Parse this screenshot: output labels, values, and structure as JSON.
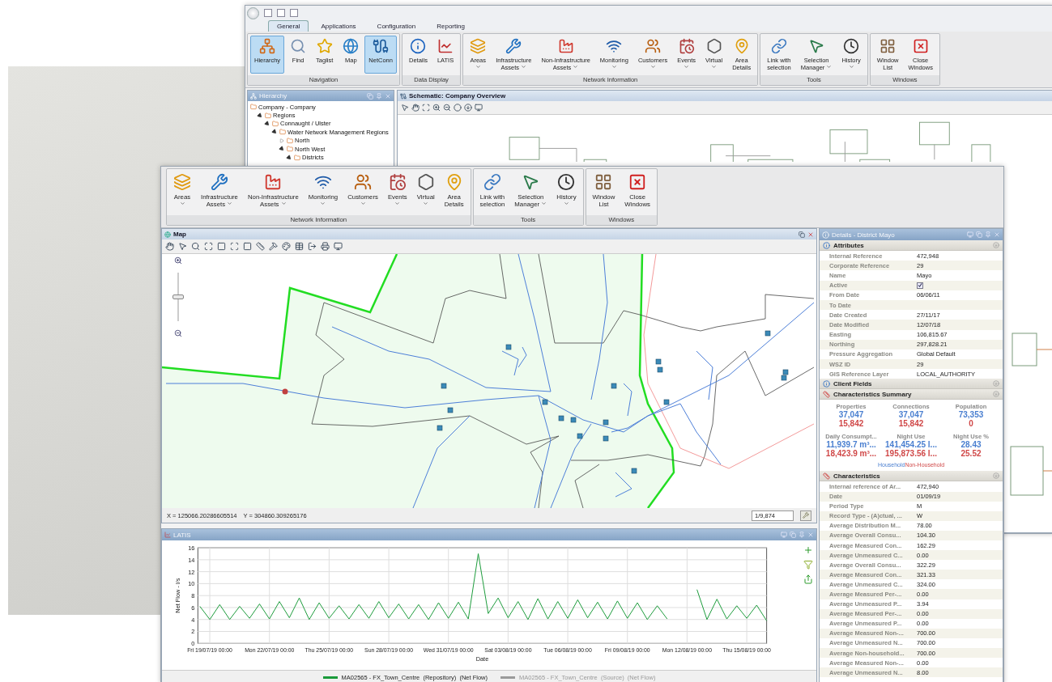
{
  "back_window": {
    "tabs": [
      {
        "label": "General",
        "selected": true
      },
      {
        "label": "Applications",
        "selected": false
      },
      {
        "label": "Configuration",
        "selected": false
      },
      {
        "label": "Reporting",
        "selected": false
      }
    ],
    "ribbon_groups": [
      {
        "kind": "navigation",
        "title": "Navigation",
        "items": [
          {
            "label": "Hierarchy",
            "selected": true
          },
          {
            "label": "Find",
            "selected": false
          },
          {
            "label": "Taglist",
            "selected": false
          },
          {
            "label": "Map",
            "selected": false
          },
          {
            "label": "NetConn",
            "selected": true
          }
        ]
      },
      {
        "kind": "data_display",
        "title": "Data Display",
        "items": [
          {
            "label": "Details",
            "selected": false
          },
          {
            "label": "LATIS",
            "selected": false
          }
        ]
      },
      {
        "kind": "network",
        "title": "Network Information",
        "items": [
          {
            "label": "Areas",
            "dropdown": true
          },
          {
            "label": "Infrastructure\nAssets",
            "dropdown": true
          },
          {
            "label": "Non-Infrastructure\nAssets",
            "dropdown": true
          },
          {
            "label": "Monitoring",
            "dropdown": true
          },
          {
            "label": "Customers",
            "dropdown": true
          },
          {
            "label": "Events",
            "dropdown": true
          },
          {
            "label": "Virtual",
            "dropdown": true
          },
          {
            "label": "Area\nDetails",
            "dropdown": false
          }
        ]
      },
      {
        "kind": "tools",
        "title": "Tools",
        "items": [
          {
            "label": "Link with\nselection",
            "dropdown": false
          },
          {
            "label": "Selection\nManager",
            "dropdown": true
          },
          {
            "label": "History",
            "dropdown": true
          }
        ]
      },
      {
        "kind": "windows",
        "title": "Windows",
        "items": [
          {
            "label": "Window\nList",
            "dropdown": false
          },
          {
            "label": "Close\nWindows",
            "dropdown": false
          }
        ]
      }
    ],
    "hierarchy": {
      "title": "Hierarchy",
      "tree": [
        {
          "label": "Company - Company",
          "children": [
            {
              "label": "Regions",
              "expanded": true,
              "children": [
                {
                  "label": "Connaught / Ulster",
                  "expanded": true,
                  "children": [
                    {
                      "label": "Water Network Management Regions",
                      "expanded": true,
                      "children": [
                        {
                          "label": "North",
                          "expanded": false
                        },
                        {
                          "label": "North West",
                          "expanded": true,
                          "children": [
                            {
                              "label": "Districts",
                              "expanded": true
                            }
                          ]
                        }
                      ]
                    }
                  ]
                }
              ]
            }
          ]
        }
      ]
    },
    "schematic": {
      "title": "Schematic: Company Overview"
    }
  },
  "front_window": {
    "ribbon_groups": [
      {
        "kind": "network",
        "title": "Network Information",
        "items": [
          {
            "label": "Areas",
            "dropdown": true
          },
          {
            "label": "Infrastructure\nAssets",
            "dropdown": true
          },
          {
            "label": "Non-Infrastructure\nAssets",
            "dropdown": true
          },
          {
            "label": "Monitoring",
            "dropdown": true
          },
          {
            "label": "Customers",
            "dropdown": true
          },
          {
            "label": "Events",
            "dropdown": true
          },
          {
            "label": "Virtual",
            "dropdown": true
          },
          {
            "label": "Area\nDetails",
            "dropdown": false
          }
        ]
      },
      {
        "kind": "tools",
        "title": "Tools",
        "items": [
          {
            "label": "Link with\nselection",
            "dropdown": false
          },
          {
            "label": "Selection\nManager",
            "dropdown": true
          },
          {
            "label": "History",
            "dropdown": true
          }
        ]
      },
      {
        "kind": "windows",
        "title": "Windows",
        "items": [
          {
            "label": "Window\nList",
            "dropdown": false
          },
          {
            "label": "Close\nWindows",
            "dropdown": false
          }
        ]
      }
    ],
    "map": {
      "title": "Map",
      "zoom": {
        "level": 0.5
      },
      "x_coordinate": "X = 125066.20286605514",
      "y_coordinate": "Y = 304860.309265176",
      "scale": "1/9,874"
    },
    "latis": {
      "title": "LATIS",
      "chart_data": {
        "type": "line",
        "grid": true,
        "xlabel": "Date",
        "ylabel": "Net Flow - l/s",
        "ylim": [
          0,
          16
        ],
        "yticks": [
          0,
          2,
          4,
          6,
          8,
          10,
          12,
          14,
          16
        ],
        "categories": [
          null,
          "Fri 19/07/19 00:00",
          null,
          null,
          null,
          null,
          null,
          "Mon 22/07/19 00:00",
          null,
          null,
          null,
          null,
          null,
          "Thu 25/07/19 00:00",
          null,
          null,
          null,
          null,
          null,
          "Sun 28/07/19 00:00",
          null,
          null,
          null,
          null,
          null,
          "Wed 31/07/19 00:00",
          null,
          null,
          null,
          null,
          null,
          "Sat 03/08/19 00:00",
          null,
          null,
          null,
          null,
          null,
          "Tue 06/08/19 00:00",
          null,
          null,
          null,
          null,
          null,
          "Fri 09/08/19 00:00",
          null,
          null,
          null,
          null,
          null,
          "Mon 12/08/19 00:00",
          null,
          null,
          null,
          null,
          null,
          "Thu 15/08/19 00:00",
          null,
          null
        ],
        "series": [
          {
            "name": "MA02565 - FX_Town_Centre  (Repository)  (Net Flow)",
            "color": "#1a9a3a",
            "values": [
              6.2,
              4.0,
              6.5,
              4.0,
              6.2,
              4.2,
              6.6,
              4.1,
              7.0,
              4.3,
              7.6,
              4.0,
              6.8,
              4.2,
              6.3,
              4.1,
              6.5,
              4.2,
              7.0,
              4.3,
              6.6,
              4.1,
              6.5,
              4.0,
              6.8,
              4.2,
              6.9,
              4.1,
              15.0,
              5.0,
              7.6,
              4.3,
              7.0,
              4.0,
              7.5,
              4.1,
              7.0,
              4.2,
              7.3,
              4.3,
              6.9,
              4.1,
              7.1,
              4.2,
              6.8,
              4.0,
              6.3,
              4.1,
              null,
              null,
              9.0,
              4.0,
              7.4,
              4.1,
              6.3,
              4.2,
              6.4,
              3.8
            ]
          }
        ]
      },
      "other_series": [
        {
          "label": "MA02565 - FX_Town_Centre  (Source)  (Net Flow)",
          "color": "#9a9a9a",
          "enabled": false
        }
      ]
    },
    "details": {
      "title": "Details - District Mayo",
      "attributes": {
        "title": "Attributes",
        "rows": [
          {
            "kind": "text",
            "label": "Internal Reference",
            "value": "472,948"
          },
          {
            "kind": "text",
            "label": "Corporate Reference",
            "value": "29"
          },
          {
            "kind": "text",
            "label": "Name",
            "value": "Mayo"
          },
          {
            "kind": "checkbox",
            "label": "Active",
            "checked": true
          },
          {
            "kind": "text",
            "label": "From Date",
            "value": "06/06/11"
          },
          {
            "kind": "text",
            "label": "To Date"
          },
          {
            "kind": "text",
            "label": "Date Created",
            "value": "27/11/17"
          },
          {
            "kind": "text",
            "label": "Date Modified",
            "value": "12/07/18"
          },
          {
            "kind": "text",
            "label": "Easting",
            "value": "106,815.67"
          },
          {
            "kind": "text",
            "label": "Northing",
            "value": "297,828.21"
          },
          {
            "kind": "text",
            "label": "Pressure Aggregation",
            "value": "Global Default"
          },
          {
            "kind": "text",
            "label": "WSZ ID",
            "value": "29"
          },
          {
            "kind": "text",
            "label": "GIS Reference Layer",
            "value": "LOCAL_AUTHORITY"
          }
        ]
      },
      "client_fields": {
        "title": "Client Fields"
      },
      "summary": {
        "title": "Characteristics Summary",
        "metrics": [
          {
            "label": "Properties",
            "household": "37,047",
            "non_household": "15,842"
          },
          {
            "label": "Connections",
            "household": "37,047",
            "non_household": "15,842"
          },
          {
            "label": "Population",
            "household": "73,353",
            "non_household": "0"
          },
          {
            "label": "Daily Consumpt...",
            "household": "11,939.7 m³...",
            "non_household": "18,423.9 m³..."
          },
          {
            "label": "Night Use",
            "household": "141,454.25 l...",
            "non_household": "195,873.56 l..."
          },
          {
            "label": "Night Use %",
            "household": "28.43",
            "non_household": "25.52"
          }
        ],
        "legend": [
          {
            "label": "Household",
            "color": "#4a7fd0"
          },
          {
            "label": "Non-Household",
            "color": "#d04848"
          }
        ]
      },
      "characteristics": {
        "title": "Characteristics",
        "rows": [
          {
            "label": "Internal reference of Ar...",
            "value": "472,940"
          },
          {
            "label": "Date",
            "value": "01/09/19"
          },
          {
            "label": "Period Type",
            "value": "M"
          },
          {
            "label": "Record Type - (A)ctual, ...",
            "value": "W"
          },
          {
            "label": "Average Distribution M...",
            "value": "78.00"
          },
          {
            "label": "Average Overall Consu...",
            "value": "104.30"
          },
          {
            "label": "Average Measured Con...",
            "value": "162.29"
          },
          {
            "label": "Average Unmeasured C...",
            "value": "0.00"
          },
          {
            "label": "Average Overall Consu...",
            "value": "322.29"
          },
          {
            "label": "Average Measured Con...",
            "value": "321.33"
          },
          {
            "label": "Average Unmeasured C...",
            "value": "324.00"
          },
          {
            "label": "Average Measured Per-...",
            "value": "0.00"
          },
          {
            "label": "Average Unmeasured P...",
            "value": "3.94"
          },
          {
            "label": "Average Measured Per-...",
            "value": "0.00"
          },
          {
            "label": "Average Unmeasured P...",
            "value": "0.00"
          },
          {
            "label": "Average Measured Non-...",
            "value": "700.00"
          },
          {
            "label": "Average Unmeasured N...",
            "value": "700.00"
          },
          {
            "label": "Average Non-household...",
            "value": "700.00"
          },
          {
            "label": "Average Measured Non-...",
            "value": "0.00"
          },
          {
            "label": "Average Unmeasured N...",
            "value": "8.00"
          }
        ]
      }
    }
  }
}
